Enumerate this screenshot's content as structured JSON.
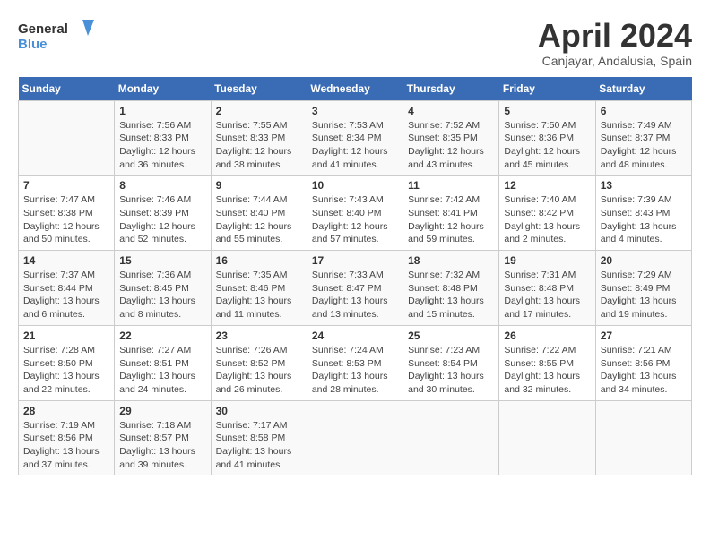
{
  "header": {
    "logo": {
      "general": "General",
      "blue": "Blue"
    },
    "title": "April 2024",
    "subtitle": "Canjayar, Andalusia, Spain"
  },
  "weekdays": [
    "Sunday",
    "Monday",
    "Tuesday",
    "Wednesday",
    "Thursday",
    "Friday",
    "Saturday"
  ],
  "weeks": [
    [
      {
        "day": "",
        "info": ""
      },
      {
        "day": "1",
        "info": "Sunrise: 7:56 AM\nSunset: 8:33 PM\nDaylight: 12 hours\nand 36 minutes."
      },
      {
        "day": "2",
        "info": "Sunrise: 7:55 AM\nSunset: 8:33 PM\nDaylight: 12 hours\nand 38 minutes."
      },
      {
        "day": "3",
        "info": "Sunrise: 7:53 AM\nSunset: 8:34 PM\nDaylight: 12 hours\nand 41 minutes."
      },
      {
        "day": "4",
        "info": "Sunrise: 7:52 AM\nSunset: 8:35 PM\nDaylight: 12 hours\nand 43 minutes."
      },
      {
        "day": "5",
        "info": "Sunrise: 7:50 AM\nSunset: 8:36 PM\nDaylight: 12 hours\nand 45 minutes."
      },
      {
        "day": "6",
        "info": "Sunrise: 7:49 AM\nSunset: 8:37 PM\nDaylight: 12 hours\nand 48 minutes."
      }
    ],
    [
      {
        "day": "7",
        "info": "Sunrise: 7:47 AM\nSunset: 8:38 PM\nDaylight: 12 hours\nand 50 minutes."
      },
      {
        "day": "8",
        "info": "Sunrise: 7:46 AM\nSunset: 8:39 PM\nDaylight: 12 hours\nand 52 minutes."
      },
      {
        "day": "9",
        "info": "Sunrise: 7:44 AM\nSunset: 8:40 PM\nDaylight: 12 hours\nand 55 minutes."
      },
      {
        "day": "10",
        "info": "Sunrise: 7:43 AM\nSunset: 8:40 PM\nDaylight: 12 hours\nand 57 minutes."
      },
      {
        "day": "11",
        "info": "Sunrise: 7:42 AM\nSunset: 8:41 PM\nDaylight: 12 hours\nand 59 minutes."
      },
      {
        "day": "12",
        "info": "Sunrise: 7:40 AM\nSunset: 8:42 PM\nDaylight: 13 hours\nand 2 minutes."
      },
      {
        "day": "13",
        "info": "Sunrise: 7:39 AM\nSunset: 8:43 PM\nDaylight: 13 hours\nand 4 minutes."
      }
    ],
    [
      {
        "day": "14",
        "info": "Sunrise: 7:37 AM\nSunset: 8:44 PM\nDaylight: 13 hours\nand 6 minutes."
      },
      {
        "day": "15",
        "info": "Sunrise: 7:36 AM\nSunset: 8:45 PM\nDaylight: 13 hours\nand 8 minutes."
      },
      {
        "day": "16",
        "info": "Sunrise: 7:35 AM\nSunset: 8:46 PM\nDaylight: 13 hours\nand 11 minutes."
      },
      {
        "day": "17",
        "info": "Sunrise: 7:33 AM\nSunset: 8:47 PM\nDaylight: 13 hours\nand 13 minutes."
      },
      {
        "day": "18",
        "info": "Sunrise: 7:32 AM\nSunset: 8:48 PM\nDaylight: 13 hours\nand 15 minutes."
      },
      {
        "day": "19",
        "info": "Sunrise: 7:31 AM\nSunset: 8:48 PM\nDaylight: 13 hours\nand 17 minutes."
      },
      {
        "day": "20",
        "info": "Sunrise: 7:29 AM\nSunset: 8:49 PM\nDaylight: 13 hours\nand 19 minutes."
      }
    ],
    [
      {
        "day": "21",
        "info": "Sunrise: 7:28 AM\nSunset: 8:50 PM\nDaylight: 13 hours\nand 22 minutes."
      },
      {
        "day": "22",
        "info": "Sunrise: 7:27 AM\nSunset: 8:51 PM\nDaylight: 13 hours\nand 24 minutes."
      },
      {
        "day": "23",
        "info": "Sunrise: 7:26 AM\nSunset: 8:52 PM\nDaylight: 13 hours\nand 26 minutes."
      },
      {
        "day": "24",
        "info": "Sunrise: 7:24 AM\nSunset: 8:53 PM\nDaylight: 13 hours\nand 28 minutes."
      },
      {
        "day": "25",
        "info": "Sunrise: 7:23 AM\nSunset: 8:54 PM\nDaylight: 13 hours\nand 30 minutes."
      },
      {
        "day": "26",
        "info": "Sunrise: 7:22 AM\nSunset: 8:55 PM\nDaylight: 13 hours\nand 32 minutes."
      },
      {
        "day": "27",
        "info": "Sunrise: 7:21 AM\nSunset: 8:56 PM\nDaylight: 13 hours\nand 34 minutes."
      }
    ],
    [
      {
        "day": "28",
        "info": "Sunrise: 7:19 AM\nSunset: 8:56 PM\nDaylight: 13 hours\nand 37 minutes."
      },
      {
        "day": "29",
        "info": "Sunrise: 7:18 AM\nSunset: 8:57 PM\nDaylight: 13 hours\nand 39 minutes."
      },
      {
        "day": "30",
        "info": "Sunrise: 7:17 AM\nSunset: 8:58 PM\nDaylight: 13 hours\nand 41 minutes."
      },
      {
        "day": "",
        "info": ""
      },
      {
        "day": "",
        "info": ""
      },
      {
        "day": "",
        "info": ""
      },
      {
        "day": "",
        "info": ""
      }
    ]
  ]
}
